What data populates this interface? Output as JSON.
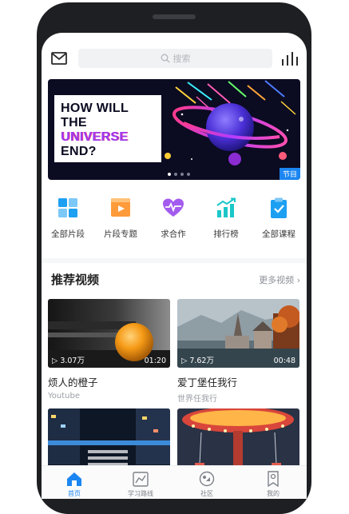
{
  "search": {
    "placeholder": "搜索"
  },
  "banner": {
    "title_line1": "HOW WILL",
    "title_line2a": "THE ",
    "title_line2b": "UNIVERSE",
    "title_line3": "END?",
    "subtitle": "/宇宙最后是怎么死的/",
    "badge": "节目",
    "slide_count": 4,
    "active_slide": 1
  },
  "categories": [
    {
      "label": "全部片段",
      "icon": "grid-icon"
    },
    {
      "label": "片段专题",
      "icon": "film-icon"
    },
    {
      "label": "求合作",
      "icon": "heart-pulse-icon"
    },
    {
      "label": "排行榜",
      "icon": "chart-rising-icon"
    },
    {
      "label": "全部课程",
      "icon": "clipboard-check-icon"
    }
  ],
  "section": {
    "title": "推荐视频",
    "more": "更多视频 ›"
  },
  "videos": [
    {
      "views": "▷ 3.07万",
      "duration": "01:20",
      "title": "烦人的橙子",
      "source": "Youtube"
    },
    {
      "views": "▷ 7.62万",
      "duration": "00:48",
      "title": "爱丁堡任我行",
      "source": "世界任我行"
    },
    {
      "views": "",
      "duration": "",
      "title": "",
      "source": ""
    },
    {
      "views": "",
      "duration": "",
      "title": "",
      "source": ""
    }
  ],
  "tabs": [
    {
      "label": "首页",
      "icon": "home-icon",
      "active": true
    },
    {
      "label": "学习路线",
      "icon": "learning-path-icon",
      "active": false
    },
    {
      "label": "社区",
      "icon": "community-icon",
      "active": false
    },
    {
      "label": "我的",
      "icon": "profile-icon",
      "active": false
    }
  ],
  "colors": {
    "accent": "#1b86f1",
    "banner_bg": "#0b0b22",
    "icon_blue": "#1ea0f2",
    "icon_orange": "#ff9b3a",
    "icon_purple": "#a35bef",
    "icon_teal": "#1bc7c9"
  }
}
